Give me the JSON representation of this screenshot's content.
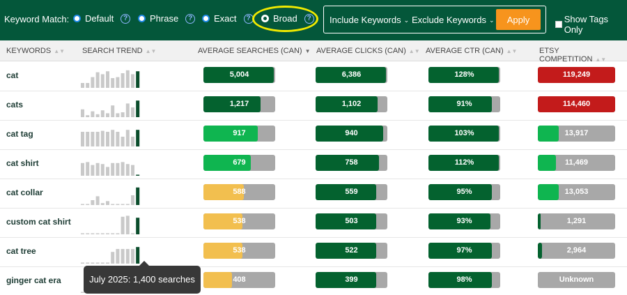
{
  "topbar": {
    "match_label": "Keyword Match:",
    "options": [
      {
        "label": "Default",
        "selected": false
      },
      {
        "label": "Phrase",
        "selected": false
      },
      {
        "label": "Exact",
        "selected": false
      },
      {
        "label": "Broad",
        "selected": true
      }
    ],
    "help_glyph": "?",
    "include_label": "Include Keywords",
    "exclude_label": "Exclude Keywords",
    "apply_label": "Apply",
    "tags_only_label": "Show Tags Only",
    "chevron_glyph": "⌄",
    "sort_glyph": "▲▼",
    "sort_active_glyph": "▼",
    "accent_color": "#04573a",
    "apply_color": "#f7941d",
    "highlight_color": "#f2ea00"
  },
  "columns": {
    "keywords": "KEYWORDS",
    "trend": "SEARCH TREND",
    "searches": "AVERAGE SEARCHES (CAN)",
    "clicks": "AVERAGE CLICKS (CAN)",
    "ctr": "AVERAGE CTR (CAN)",
    "competition": "ETSY COMPETITION"
  },
  "colors": {
    "dark_green": "#04622f",
    "bright_green": "#0fb550",
    "yellow": "#f2bf4f",
    "red": "#c31b1b",
    "gray": "#a8a8a8"
  },
  "rows": [
    {
      "keyword": "cat",
      "trend": [
        0.25,
        0.25,
        0.55,
        0.8,
        0.7,
        0.85,
        0.5,
        0.55,
        0.75,
        0.9,
        0.7,
        0.85
      ],
      "searches": {
        "text": "5,004",
        "fill": 0.98,
        "color": "dark_green"
      },
      "clicks": {
        "text": "6,386",
        "fill": 0.98,
        "color": "dark_green"
      },
      "ctr": {
        "text": "128%",
        "fill": 0.98,
        "color": "dark_green"
      },
      "competition": {
        "text": "119,249",
        "fill": 1.0,
        "color": "red"
      }
    },
    {
      "keyword": "cats",
      "trend": [
        0.4,
        0.1,
        0.3,
        0.15,
        0.35,
        0.2,
        0.6,
        0.2,
        0.25,
        0.7,
        0.5,
        0.85
      ],
      "searches": {
        "text": "1,217",
        "fill": 0.8,
        "color": "dark_green"
      },
      "clicks": {
        "text": "1,102",
        "fill": 0.86,
        "color": "dark_green"
      },
      "ctr": {
        "text": "91%",
        "fill": 0.88,
        "color": "dark_green"
      },
      "competition": {
        "text": "114,460",
        "fill": 1.0,
        "color": "red"
      }
    },
    {
      "keyword": "cat tag",
      "trend": [
        0.75,
        0.75,
        0.75,
        0.75,
        0.8,
        0.75,
        0.85,
        0.75,
        0.5,
        0.85,
        0.5,
        0.85
      ],
      "searches": {
        "text": "917",
        "fill": 0.76,
        "color": "bright_green"
      },
      "clicks": {
        "text": "940",
        "fill": 0.94,
        "color": "dark_green"
      },
      "ctr": {
        "text": "103%",
        "fill": 0.98,
        "color": "dark_green"
      },
      "competition": {
        "text": "13,917",
        "fill": 0.27,
        "color": "bright_green"
      }
    },
    {
      "keyword": "cat shirt",
      "trend": [
        0.65,
        0.7,
        0.55,
        0.65,
        0.6,
        0.45,
        0.65,
        0.65,
        0.7,
        0.6,
        0.55,
        0.05
      ],
      "searches": {
        "text": "679",
        "fill": 0.66,
        "color": "bright_green"
      },
      "clicks": {
        "text": "758",
        "fill": 0.88,
        "color": "dark_green"
      },
      "ctr": {
        "text": "112%",
        "fill": 0.98,
        "color": "dark_green"
      },
      "competition": {
        "text": "11,469",
        "fill": 0.23,
        "color": "bright_green"
      }
    },
    {
      "keyword": "cat collar",
      "trend": [
        0.03,
        0.03,
        0.25,
        0.45,
        0.1,
        0.2,
        0.03,
        0.03,
        0.03,
        0.03,
        0.5,
        0.9
      ],
      "searches": {
        "text": "588",
        "fill": 0.56,
        "color": "yellow"
      },
      "clicks": {
        "text": "559",
        "fill": 0.84,
        "color": "dark_green"
      },
      "ctr": {
        "text": "95%",
        "fill": 0.88,
        "color": "dark_green"
      },
      "competition": {
        "text": "13,053",
        "fill": 0.27,
        "color": "bright_green"
      }
    },
    {
      "keyword": "custom cat shirt",
      "trend": [
        0.03,
        0.03,
        0.03,
        0.03,
        0.03,
        0.03,
        0.03,
        0.03,
        0.9,
        0.95,
        0.03,
        0.85
      ],
      "searches": {
        "text": "538",
        "fill": 0.54,
        "color": "yellow"
      },
      "clicks": {
        "text": "503",
        "fill": 0.84,
        "color": "dark_green"
      },
      "ctr": {
        "text": "93%",
        "fill": 0.86,
        "color": "dark_green"
      },
      "competition": {
        "text": "1,291",
        "fill": 0.04,
        "color": "dark_green"
      }
    },
    {
      "keyword": "cat tree",
      "trend": [
        0.03,
        0.03,
        0.03,
        0.03,
        0.03,
        0.03,
        0.6,
        0.75,
        0.75,
        0.75,
        0.75,
        0.85
      ],
      "searches": {
        "text": "538",
        "fill": 0.54,
        "color": "yellow"
      },
      "clicks": {
        "text": "522",
        "fill": 0.84,
        "color": "dark_green"
      },
      "ctr": {
        "text": "97%",
        "fill": 0.88,
        "color": "dark_green"
      },
      "competition": {
        "text": "2,964",
        "fill": 0.05,
        "color": "dark_green"
      }
    },
    {
      "keyword": "ginger cat era",
      "trend": [
        0.03,
        0.03,
        0.03,
        0.03,
        0.03,
        0.03,
        0.03,
        0.03,
        0.03,
        0.03,
        0.03,
        0.03
      ],
      "searches": {
        "text": "408",
        "fill": 0.4,
        "color": "yellow"
      },
      "clicks": {
        "text": "399",
        "fill": 0.84,
        "color": "dark_green"
      },
      "ctr": {
        "text": "98%",
        "fill": 0.88,
        "color": "dark_green"
      },
      "competition": {
        "text": "Unknown",
        "fill": 0.0,
        "color": "gray"
      }
    }
  ],
  "tooltip": {
    "text": "July 2025: 1,400 searches"
  }
}
